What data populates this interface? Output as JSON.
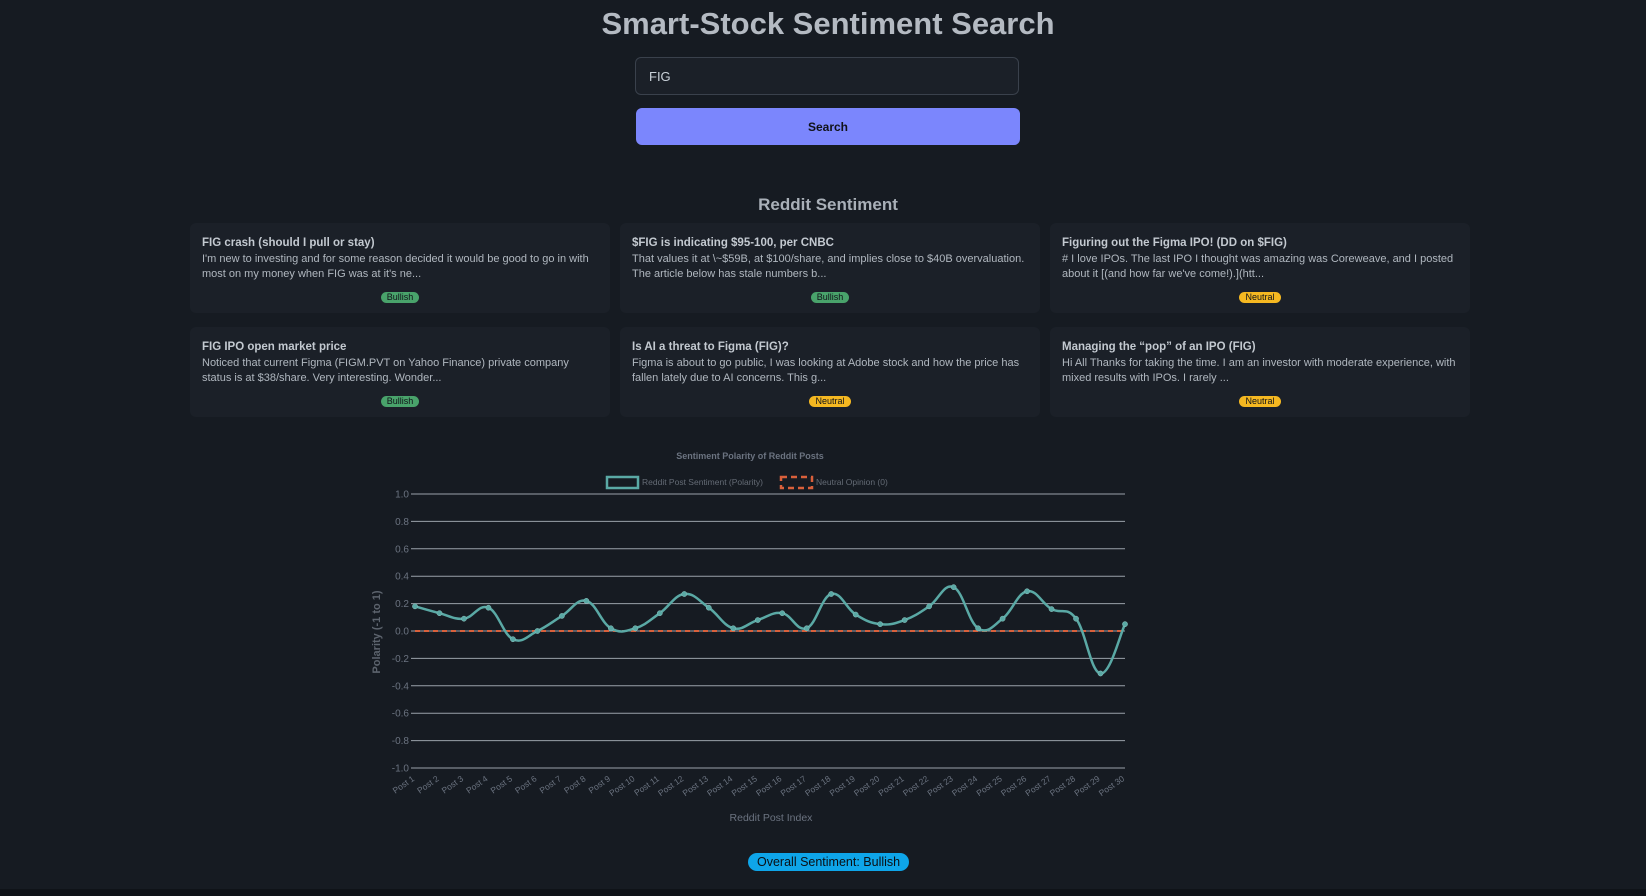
{
  "header": {
    "title": "Smart-Stock Sentiment Search"
  },
  "search": {
    "value": "FIG",
    "button_label": "Search"
  },
  "reddit": {
    "section_title": "Reddit Sentiment",
    "posts": [
      {
        "title": "FIG crash (should I pull or stay)",
        "excerpt": "I'm new to investing and for some reason decided it would be good to go in with most on my money when FIG was at it's ne...",
        "sentiment": "Bullish"
      },
      {
        "title": "$FIG is indicating $95-100, per CNBC",
        "excerpt": "That values it at \\~$59B, at $100/share, and implies close to $40B overvaluation. The article below has stale numbers b...",
        "sentiment": "Bullish"
      },
      {
        "title": "Figuring out the Figma IPO! (DD on $FIG)",
        "excerpt": "# I love IPOs. The last IPO I thought was amazing was Coreweave, and I posted about it [(and how far we've come!).](htt...",
        "sentiment": "Neutral"
      },
      {
        "title": "FIG IPO open market price",
        "excerpt": "Noticed that current Figma (FIGM.PVT on Yahoo Finance) private company status is at $38/share. Very interesting. Wonder...",
        "sentiment": "Bullish"
      },
      {
        "title": "Is AI a threat to Figma (FIG)?",
        "excerpt": "Figma is about to go public, I was looking at Adobe stock and how the price has fallen lately due to AI concerns. This g...",
        "sentiment": "Neutral"
      },
      {
        "title": "Managing the “pop” of an IPO (FIG)",
        "excerpt": "Hi All Thanks for taking the time. I am an investor with moderate experience, with mixed results with IPOs. I rarely ...",
        "sentiment": "Neutral"
      }
    ]
  },
  "colors": {
    "bullish": "#49a36b",
    "neutral": "#f5b821",
    "accent": "#7b86fd",
    "series_line": "#5aa9a5",
    "neutral_line": "#d9603b",
    "overall_badge": "#0ea5e9"
  },
  "chart_data": {
    "type": "line",
    "title": "Sentiment Polarity of Reddit Posts",
    "xlabel": "Reddit Post Index",
    "ylabel": "Polarity (-1 to 1)",
    "ylim": [
      -1,
      1
    ],
    "yticks": [
      "1.0",
      "0.8",
      "0.6",
      "0.4",
      "0.2",
      "0.0",
      "-0.2",
      "-0.4",
      "-0.6",
      "-0.8",
      "-1.0"
    ],
    "categories": [
      "Post 1",
      "Post 2",
      "Post 3",
      "Post 4",
      "Post 5",
      "Post 6",
      "Post 7",
      "Post 8",
      "Post 9",
      "Post 10",
      "Post 11",
      "Post 12",
      "Post 13",
      "Post 14",
      "Post 15",
      "Post 16",
      "Post 17",
      "Post 18",
      "Post 19",
      "Post 20",
      "Post 21",
      "Post 22",
      "Post 23",
      "Post 24",
      "Post 25",
      "Post 26",
      "Post 27",
      "Post 28",
      "Post 29",
      "Post 30"
    ],
    "legend_position": "top",
    "grid": true,
    "series": [
      {
        "name": "Reddit Post Sentiment (Polarity)",
        "values": [
          0.18,
          0.13,
          0.09,
          0.17,
          -0.06,
          0.0,
          0.11,
          0.22,
          0.02,
          0.02,
          0.13,
          0.27,
          0.17,
          0.02,
          0.08,
          0.13,
          0.02,
          0.27,
          0.12,
          0.05,
          0.08,
          0.18,
          0.32,
          0.02,
          0.09,
          0.29,
          0.16,
          0.09,
          -0.31,
          0.05
        ]
      },
      {
        "name": "Neutral Opinion (0)",
        "values": [
          0,
          0,
          0,
          0,
          0,
          0,
          0,
          0,
          0,
          0,
          0,
          0,
          0,
          0,
          0,
          0,
          0,
          0,
          0,
          0,
          0,
          0,
          0,
          0,
          0,
          0,
          0,
          0,
          0,
          0
        ]
      }
    ]
  },
  "overall": {
    "label": "Overall Sentiment: Bullish"
  }
}
